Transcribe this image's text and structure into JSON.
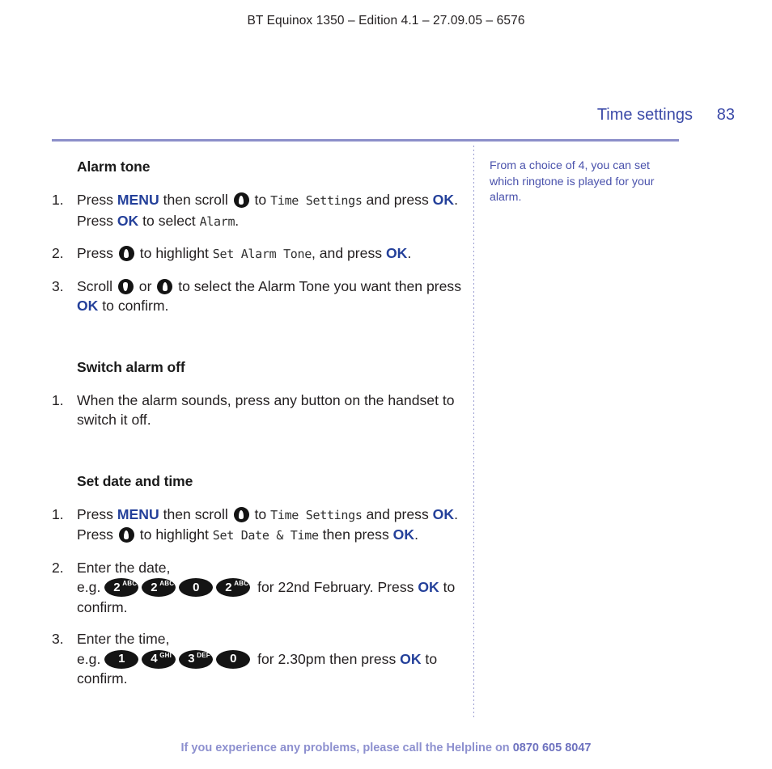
{
  "document": {
    "edition_line": "BT Equinox 1350 – Edition 4.1 – 27.09.05 – 6576",
    "running_head": {
      "section": "Time settings",
      "page_number": "83"
    },
    "footer": {
      "text": "If you experience any problems, please call the Helpline on ",
      "phone": "0870 605 8047"
    }
  },
  "colors": {
    "accent_blue": "#24409a",
    "head_blue": "#3b4aa8",
    "rule_purple": "#8c8fc9",
    "note_blue": "#4a52ac",
    "footer_purple": "#8d90cf"
  },
  "side_note": {
    "text": "From a choice of 4, you can set which ringtone is played for your alarm."
  },
  "sections": [
    {
      "title": "Alarm tone",
      "steps": [
        {
          "number": "1.",
          "parts": {
            "t1": "Press ",
            "menu": "MENU",
            "t2": " then scroll ",
            "t3": " to ",
            "lcd1": "Time Settings",
            "t4": " and press ",
            "ok1": "OK",
            "t5": ". Press ",
            "ok2": "OK",
            "t6": " to select ",
            "lcd2": "Alarm",
            "t7": "."
          }
        },
        {
          "number": "2.",
          "parts": {
            "t1": "Press ",
            "t2": " to highlight ",
            "lcd1": "Set Alarm Tone",
            "t3": ", and press ",
            "ok1": "OK",
            "t4": "."
          }
        },
        {
          "number": "3.",
          "parts": {
            "t1": "Scroll ",
            "t2": " or ",
            "t3": " to select the Alarm Tone you want then press ",
            "ok1": "OK",
            "t4": " to confirm."
          }
        }
      ]
    },
    {
      "title": "Switch alarm off",
      "steps": [
        {
          "number": "1.",
          "parts": {
            "t1": "When the alarm sounds, press any button on the handset to switch it off."
          }
        }
      ]
    },
    {
      "title": "Set date and time",
      "steps": [
        {
          "number": "1.",
          "parts": {
            "t1": "Press ",
            "menu": "MENU",
            "t2": " then scroll ",
            "t3": " to ",
            "lcd1": "Time Settings",
            "t4": " and press ",
            "ok1": "OK",
            "t5": ". Press ",
            "t6": " to highlight ",
            "lcd2": "Set Date & Time",
            "t7": " then press ",
            "ok2": "OK",
            "t8": "."
          }
        },
        {
          "number": "2.",
          "parts": {
            "t1": "Enter the date,",
            "t2": "e.g. ",
            "t3": " for 22nd February. Press ",
            "ok1": "OK",
            "t4": " to confirm."
          },
          "keys": [
            {
              "digit": "2",
              "letters": "ABC"
            },
            {
              "digit": "2",
              "letters": "ABC"
            },
            {
              "digit": "0",
              "letters": ""
            },
            {
              "digit": "2",
              "letters": "ABC"
            }
          ]
        },
        {
          "number": "3.",
          "parts": {
            "t1": "Enter the time,",
            "t2": "e.g. ",
            "t3": " for 2.30pm then press ",
            "ok1": "OK",
            "t4": " to confirm."
          },
          "keys": [
            {
              "digit": "1",
              "letters": ""
            },
            {
              "digit": "4",
              "letters": "GHI"
            },
            {
              "digit": "3",
              "letters": "DEF"
            },
            {
              "digit": "0",
              "letters": ""
            }
          ]
        }
      ]
    }
  ],
  "icons": {
    "scroll_up": "scroll-up-icon",
    "scroll_down": "scroll-down-icon"
  }
}
